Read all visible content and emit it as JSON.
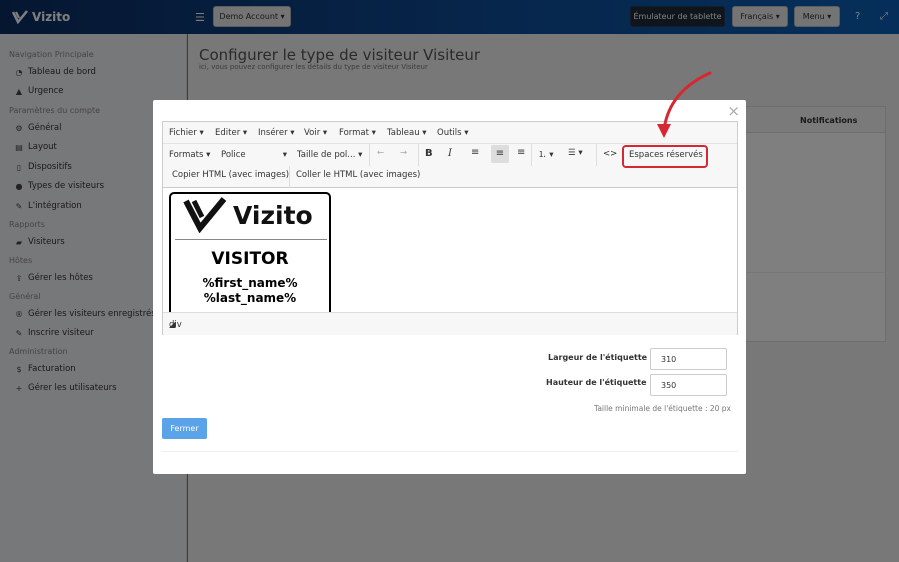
{
  "app": {
    "name": "Vizito"
  },
  "header": {
    "account_button": "Demo Account",
    "emulator_button": "Émulateur de tablette",
    "language_button": "Français",
    "menu_button": "Menu"
  },
  "sidebar": {
    "sections": [
      {
        "title": "Navigation Principale"
      },
      {
        "title": "Paramètres du compte"
      },
      {
        "title": "Rapports"
      },
      {
        "title": "Hôtes"
      },
      {
        "title": "Général"
      },
      {
        "title": "Administration"
      }
    ],
    "items": [
      {
        "label": "Tableau de bord",
        "icon": "dashboard-icon"
      },
      {
        "label": "Urgence",
        "icon": "warning-icon"
      },
      {
        "label": "Général",
        "icon": "gear-icon"
      },
      {
        "label": "Layout",
        "icon": "layout-icon"
      },
      {
        "label": "Dispositifs",
        "icon": "tablet-icon"
      },
      {
        "label": "Types de visiteurs",
        "icon": "users-icon"
      },
      {
        "label": "L'intégration",
        "icon": "plug-icon"
      },
      {
        "label": "Visiteurs",
        "icon": "book-icon"
      },
      {
        "label": "Gérer les hôtes",
        "icon": "upload-icon"
      },
      {
        "label": "Gérer les visiteurs enregistrés",
        "icon": "registered-icon"
      },
      {
        "label": "Inscrire visiteur",
        "icon": "pencil-icon"
      },
      {
        "label": "Facturation",
        "icon": "dollar-icon"
      },
      {
        "label": "Gérer les utilisateurs",
        "icon": "user-plus-icon"
      }
    ]
  },
  "page": {
    "title": "Configurer le type de visiteur Visiteur",
    "subtitle": "ici, vous pouvez configurer les détails du type de visiteur Visiteur",
    "notifications_header": "Notifications"
  },
  "modal": {
    "close_symbol": "×",
    "editor": {
      "menus": [
        "Fichier",
        "Editer",
        "Insérer",
        "Voir",
        "Format",
        "Tableau",
        "Outils"
      ],
      "formats_label": "Formats",
      "font_label": "Police",
      "size_label": "Taille de pol...",
      "placeholders_button": "Espaces réservés",
      "copy_html_button": "Copier HTML (avec images)",
      "paste_html_button": "Coller le HTML (avec images)",
      "status_path": "div",
      "badge": {
        "logo_text": "Vizito",
        "visitor_text": "VISITOR",
        "first_name": "%first_name%",
        "last_name": "%last_name%"
      }
    },
    "label_width": {
      "label": "Largeur de l'étiquette",
      "value": "310"
    },
    "label_height": {
      "label": "Hauteur de l'étiquette",
      "value": "350"
    },
    "min_size_note": "Taille minimale de l'étiquette : 20 px",
    "close_button": "Fermer"
  },
  "colors": {
    "accent": "#5aa3e8",
    "highlight": "#d52832",
    "topbar": "#0e4c98"
  }
}
